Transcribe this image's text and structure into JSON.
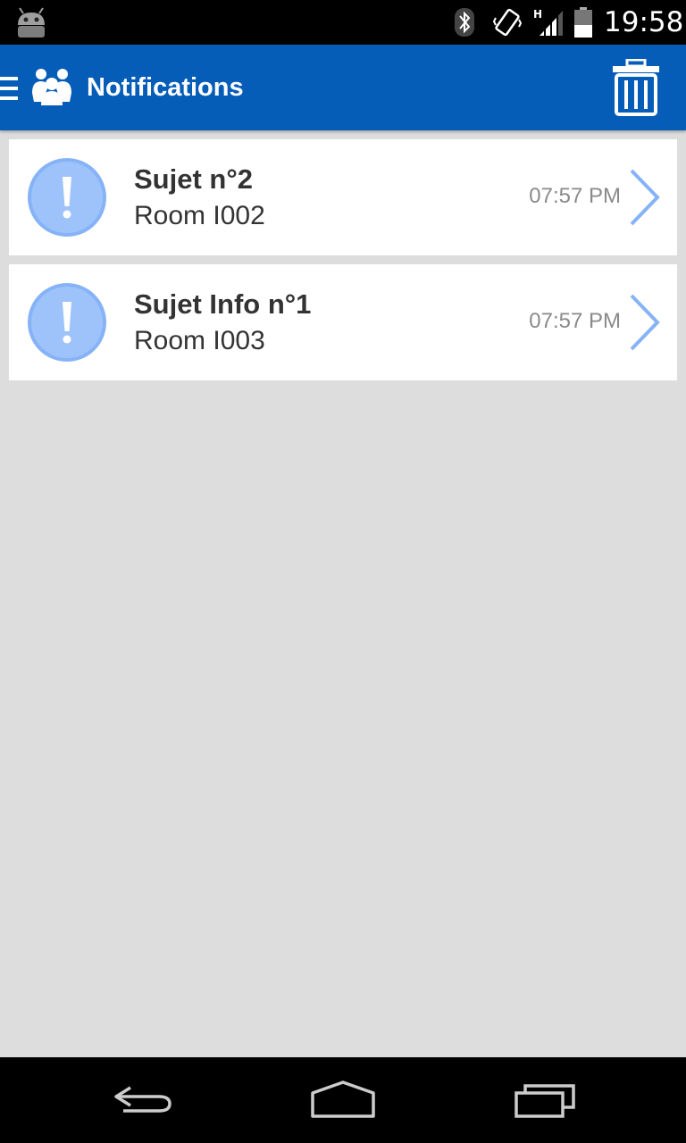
{
  "status_bar": {
    "time": "19:58",
    "icons": [
      "android-icon",
      "bluetooth-icon",
      "vibrate-icon",
      "signal-h-icon",
      "battery-icon"
    ]
  },
  "app_bar": {
    "title": "Notifications",
    "icons": [
      "menu-icon",
      "people-icon",
      "trash-icon"
    ],
    "color": "#055db8"
  },
  "notifications": [
    {
      "title": "Sujet n°2",
      "room": "Room I002",
      "time": "07:57 PM"
    },
    {
      "title": "Sujet Info n°1",
      "room": "Room I003",
      "time": "07:57 PM"
    }
  ],
  "nav_bar": {
    "icons": [
      "back-icon",
      "home-icon",
      "recent-apps-icon"
    ]
  },
  "colors": {
    "accent": "#86b3f7",
    "background": "#dddddd",
    "card": "#ffffff"
  }
}
